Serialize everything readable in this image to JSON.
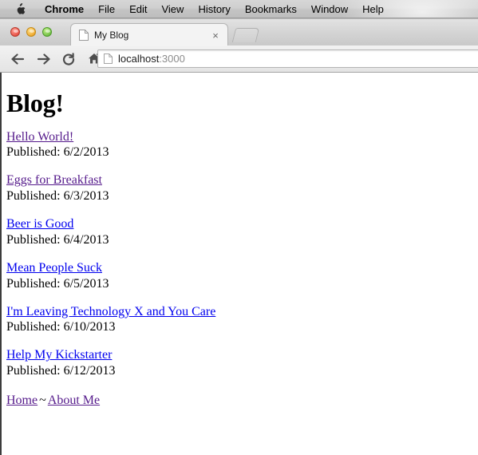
{
  "menubar": {
    "apple_icon": "apple-logo",
    "items": [
      {
        "label": "Chrome",
        "bold": true
      },
      {
        "label": "File",
        "bold": false
      },
      {
        "label": "Edit",
        "bold": false
      },
      {
        "label": "View",
        "bold": false
      },
      {
        "label": "History",
        "bold": false
      },
      {
        "label": "Bookmarks",
        "bold": false
      },
      {
        "label": "Window",
        "bold": false
      },
      {
        "label": "Help",
        "bold": false
      }
    ]
  },
  "window": {
    "traffic_lights": {
      "close_color": "#e8554a",
      "minimize_color": "#f0ac33",
      "zoom_color": "#74c147"
    },
    "tab": {
      "title": "My Blog",
      "favicon": "page-icon",
      "close_glyph": "×"
    },
    "newtab_label": "",
    "toolbar": {
      "back_glyph": "←",
      "forward_glyph": "→",
      "reload_glyph": "↻",
      "home_glyph": "⌂",
      "url_host": "localhost",
      "url_port": ":3000",
      "url_favicon": "page-icon"
    }
  },
  "page": {
    "title": "Blog!",
    "posts": [
      {
        "title": "Hello World!",
        "published_label": "Published: 6/2/2013",
        "state": "visited"
      },
      {
        "title": "Eggs for Breakfast",
        "published_label": "Published: 6/3/2013",
        "state": "visited"
      },
      {
        "title": "Beer is Good",
        "published_label": "Published: 6/4/2013",
        "state": "unvisited"
      },
      {
        "title": "Mean People Suck",
        "published_label": "Published: 6/5/2013",
        "state": "unvisited"
      },
      {
        "title": "I'm Leaving Technology X and You Care",
        "published_label": "Published: 6/10/2013",
        "state": "unvisited"
      },
      {
        "title": "Help My Kickstarter",
        "published_label": "Published: 6/12/2013",
        "state": "unvisited"
      }
    ],
    "footer": {
      "home_label": "Home",
      "separator": "~",
      "about_label": "About Me"
    },
    "colors": {
      "visited_link": "#551a8b",
      "unvisited_link": "#0000ee",
      "text": "#000000",
      "background": "#ffffff"
    }
  }
}
